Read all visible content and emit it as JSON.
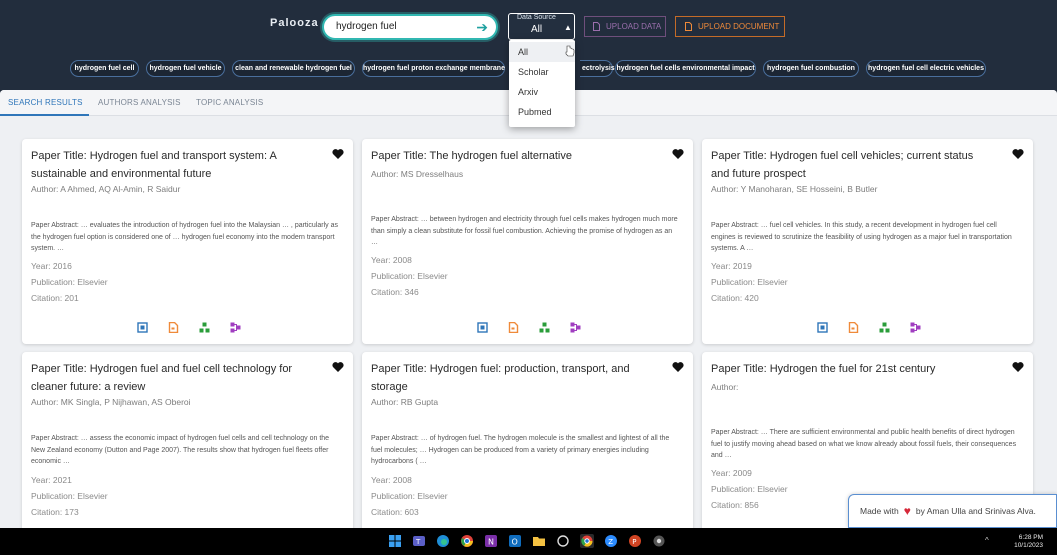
{
  "header": {
    "brand": "Palooza",
    "search_value": "hydrogen fuel",
    "data_source_label": "Data Source",
    "data_source_value": "All",
    "upload_data_label": "UPLOAD DATA",
    "upload_document_label": "UPLOAD DOCUMENT"
  },
  "dropdown": {
    "options": [
      "All",
      "Scholar",
      "Arxiv",
      "Pubmed"
    ],
    "selected": "All"
  },
  "chips": [
    "hydrogen fuel cell",
    "hydrogen fuel vehicle",
    "clean and renewable hydrogen fuel",
    "hydrogen fuel proton exchange membrane",
    "ectrolysis",
    "hydrogen fuel cells environmental impact",
    "hydrogen fuel combustion",
    "hydrogen fuel cell electric vehicles"
  ],
  "tabs": [
    "SEARCH RESULTS",
    "AUTHORS ANALYSIS",
    "TOPIC ANALYSIS"
  ],
  "cards": [
    {
      "title": "Paper Title: Hydrogen fuel and transport system: A sustainable and environmental future",
      "author": "Author: A Ahmed, AQ Al-Amin, R Saidur",
      "abstract": "Paper Abstract: … evaluates the introduction of hydrogen fuel into the Malaysian … , particularly as the hydrogen fuel option is considered one of … hydrogen fuel economy into the modern transport system. …",
      "year": "Year: 2016",
      "publication": "Publication: Elsevier",
      "citation": "Citation: 201"
    },
    {
      "title": "Paper Title: The hydrogen fuel alternative",
      "author": "Author: MS Dresselhaus",
      "abstract": "Paper Abstract: … between hydrogen and electricity through fuel cells makes hydrogen much more than simply a clean substitute for fossil fuel combustion. Achieving the promise of hydrogen as an …",
      "year": "Year: 2008",
      "publication": "Publication: Elsevier",
      "citation": "Citation: 346"
    },
    {
      "title": "Paper Title: Hydrogen fuel cell vehicles; current status and future prospect",
      "author": "Author: Y Manoharan, SE Hosseini, B Butler",
      "abstract": "Paper Abstract: … fuel cell vehicles. In this study, a recent development in hydrogen fuel cell engines is reviewed to scrutinize the feasibility of using hydrogen as a major fuel in transportation systems. A …",
      "year": "Year: 2019",
      "publication": "Publication: Elsevier",
      "citation": "Citation: 420"
    },
    {
      "title": "Paper Title: Hydrogen fuel and fuel cell technology for cleaner future: a review",
      "author": "Author: MK Singla, P Nijhawan, AS Oberoi",
      "abstract": "Paper Abstract: … assess the economic impact of hydrogen fuel cells and cell technology on the New Zealand economy (Dutton and Page 2007). The results show that hydrogen fuel fleets offer economic …",
      "year": "Year: 2021",
      "publication": "Publication: Elsevier",
      "citation": "Citation: 173"
    },
    {
      "title": "Paper Title: Hydrogen fuel: production, transport, and storage",
      "author": "Author: RB Gupta",
      "abstract": "Paper Abstract: … of hydrogen fuel. The hydrogen molecule is the smallest and lightest of all the fuel molecules; … Hydrogen can be produced from a variety of primary energies including hydrocarbons ( …",
      "year": "Year: 2008",
      "publication": "Publication: Elsevier",
      "citation": "Citation: 603"
    },
    {
      "title": "Paper Title: Hydrogen the fuel for 21st century",
      "author": "Author:",
      "abstract": "Paper Abstract: … There are sufficient environmental and public health benefits of direct hydrogen fuel to justify moving ahead based on what we know already about fossil fuels, their consequences and …",
      "year": "Year: 2009",
      "publication": "Publication: Elsevier",
      "citation": "Citation: 856"
    }
  ],
  "footer_badge": {
    "made_with": "Made with",
    "by_text": "by Aman Ulla and Srinivas Alva."
  },
  "taskbar": {
    "time": "6:28 PM",
    "date": "10/1/2023"
  },
  "colors": {
    "accent": "#2f76b9",
    "search_border": "#31b7b1",
    "upload_data": "#9b6fad",
    "upload_document": "#ef8a3a",
    "chip_border": "#4a6f9d"
  }
}
